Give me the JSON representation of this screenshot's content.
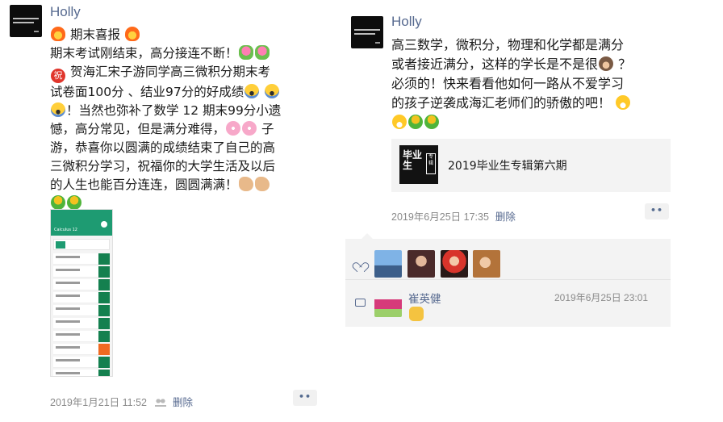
{
  "post_left": {
    "author": "Holly",
    "lines": [
      [
        "期末喜报"
      ],
      [
        "期末考试刚结束，高分接连不断！"
      ],
      [
        "贺海汇宋子游同学高三微积分期末考"
      ],
      [
        "试卷面100分 、结业97分的好成绩"
      ],
      [
        "！当然也弥补了数学 12 期末99分小遗"
      ],
      [
        "憾，高分常见，但是满分难得，",
        " 子"
      ],
      [
        "游，恭喜你以圆满的成绩结束了自己的高"
      ],
      [
        "三微积分学习，祝福你的大学生活及以后"
      ],
      [
        "的人生也能百分连连，圆圆满满！"
      ]
    ],
    "screenshot_title": "Calculus 12",
    "timestamp": "2019年1月21日 11:52",
    "delete_label": "删除",
    "more_label": "••"
  },
  "post_right": {
    "author": "Holly",
    "lines": [
      "高三数学，微积分，物理和化学都是满分",
      "或者接近满分，这样的学长是不是很",
      "必须的！快来看看他如何一路从不爱学习",
      "的孩子逆袭成海汇老师们的骄傲的吧！"
    ],
    "line2_tail": " ？",
    "share_title": "2019毕业生专辑第六期",
    "share_thumb_text": "毕业生",
    "share_thumb_badge": "专辑",
    "timestamp": "2019年6月25日 17:35",
    "delete_label": "删除",
    "more_label": "••",
    "comment": {
      "name": "崔英健",
      "time": "2019年6月25日 23:01"
    }
  }
}
